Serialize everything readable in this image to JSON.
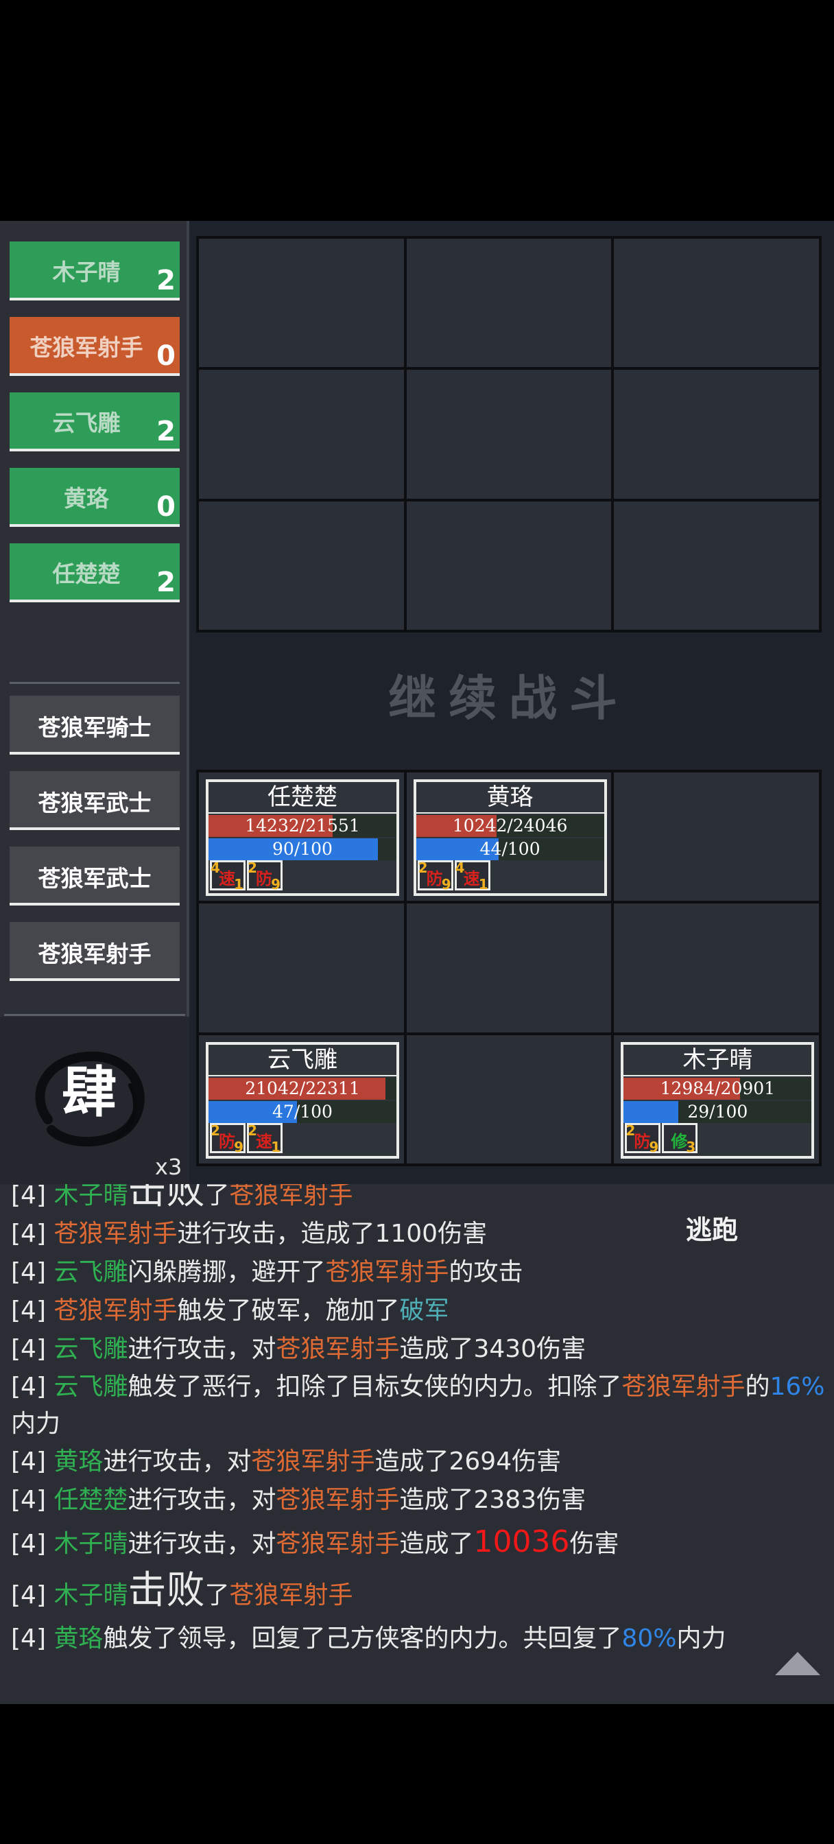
{
  "roster": {
    "allies": [
      {
        "name": "木子晴",
        "count": "2",
        "state": "ally"
      },
      {
        "name": "苍狼军射手",
        "count": "0",
        "state": "active"
      },
      {
        "name": "云飞雕",
        "count": "2",
        "state": "ally"
      },
      {
        "name": "黄珞",
        "count": "0",
        "state": "ally"
      },
      {
        "name": "任楚楚",
        "count": "2",
        "state": "ally"
      }
    ],
    "enemies": [
      "苍狼军骑士",
      "苍狼军武士",
      "苍狼军武士",
      "苍狼军射手"
    ]
  },
  "skill": {
    "glyph": "肆",
    "multiplier": "x3"
  },
  "continue_label": "继续战斗",
  "units": {
    "renchuchu": {
      "name": "任楚楚",
      "hp_text": "14232/21551",
      "hp": 0.66,
      "mp_text": "90/100",
      "mp": 0.9,
      "buffs": [
        {
          "label": "速",
          "n1": "4",
          "n2": "1"
        },
        {
          "label": "防",
          "n1": "2",
          "n2": "9"
        }
      ]
    },
    "huangluo": {
      "name": "黄珞",
      "hp_text": "10242/24046",
      "hp": 0.43,
      "mp_text": "44/100",
      "mp": 0.44,
      "buffs": [
        {
          "label": "防",
          "n1": "2",
          "n2": "9"
        },
        {
          "label": "速",
          "n1": "4",
          "n2": "1"
        }
      ]
    },
    "yunfeidiao": {
      "name": "云飞雕",
      "hp_text": "21042/22311",
      "hp": 0.94,
      "mp_text": "47/100",
      "mp": 0.47,
      "buffs": [
        {
          "label": "防",
          "n1": "2",
          "n2": "9"
        },
        {
          "label": "速",
          "n1": "2",
          "n2": "1"
        }
      ]
    },
    "muziqing": {
      "name": "木子晴",
      "hp_text": "12984/20901",
      "hp": 0.62,
      "mp_text": "29/100",
      "mp": 0.29,
      "buffs": [
        {
          "label": "防",
          "n1": "2",
          "n2": "9"
        },
        {
          "label": "修",
          "n1": "",
          "n2": "3"
        }
      ]
    }
  },
  "log": {
    "flee_label": "逃跑",
    "l0": {
      "p": "[4] ",
      "a": "木子晴",
      "b": "击败",
      "c": "了",
      "d": "苍狼军射手"
    },
    "l1": {
      "p": "[4] ",
      "a": "苍狼军射手",
      "b": "进行攻击，造成了1100伤害"
    },
    "l2": {
      "p": "[4] ",
      "a": "云飞雕",
      "b": "闪躲腾挪，避开了",
      "c": "苍狼军射手",
      "d": "的攻击"
    },
    "l3": {
      "p": "[4] ",
      "a": "苍狼军射手",
      "b": "触发了破军，施加了",
      "c": "破军"
    },
    "l4": {
      "p": "[4] ",
      "a": "云飞雕",
      "b": "进行攻击，对",
      "c": "苍狼军射手",
      "d": "造成了3430伤害"
    },
    "l5": {
      "p": "[4] ",
      "a": "云飞雕",
      "b": "触发了恶行，扣除了目标女侠的内力。扣除了",
      "c": "苍狼军射手",
      "d": "的",
      "e": "16%",
      "f": "内力"
    },
    "l6": {
      "p": "[4] ",
      "a": "黄珞",
      "b": "进行攻击，对",
      "c": "苍狼军射手",
      "d": "造成了2694伤害"
    },
    "l7": {
      "p": "[4] ",
      "a": "任楚楚",
      "b": "进行攻击，对",
      "c": "苍狼军射手",
      "d": "造成了2383伤害"
    },
    "l8": {
      "p": "[4] ",
      "a": "木子晴",
      "b": "进行攻击，对",
      "c": "苍狼军射手",
      "d": "造成了",
      "e": "10036",
      "f": "伤害"
    },
    "l9": {
      "p": "[4] ",
      "a": "木子晴",
      "b": "击败",
      "c": "了",
      "d": "苍狼军射手"
    },
    "l10": {
      "p": "[4] ",
      "a": "黄珞",
      "b": "触发了领导，回复了己方侠客的内力。共回复了",
      "c": "80%",
      "d": "内力"
    }
  },
  "colors": {
    "ally": "#2e9d58",
    "active": "#c85a2e",
    "hp": "#b94236",
    "mp": "#2a77e0",
    "ally_text": "#2fb152",
    "enemy_text": "#e06a34"
  }
}
